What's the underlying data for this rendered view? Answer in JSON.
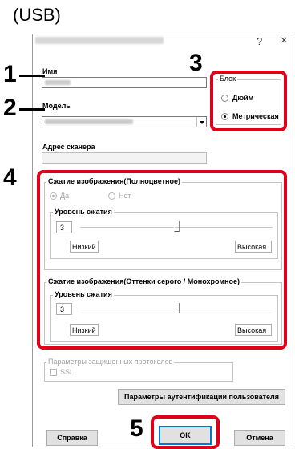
{
  "caption": "(USB)",
  "window": {
    "help_glyph": "?",
    "close_glyph": "×"
  },
  "callouts": [
    "1",
    "2",
    "3",
    "4",
    "5"
  ],
  "fields": {
    "name_label": "Имя",
    "model_label": "Модель",
    "scanner_address_label": "Адрес сканера"
  },
  "unit_group": {
    "title": "Блок",
    "options": [
      "Дюйм",
      "Метрическая"
    ],
    "selected": "Метрическая"
  },
  "color_compression": {
    "title": "Сжатие изображения(Полноцветное)",
    "yes_label": "Да",
    "no_label": "Нет",
    "level_title": "Уровень сжатия",
    "level_value": "3",
    "low_label": "Низкий",
    "high_label": "Высокая"
  },
  "gray_compression": {
    "title": "Сжатие изображения(Оттенки серого / Монохромное)",
    "level_title": "Уровень сжатия",
    "level_value": "3",
    "low_label": "Низкий",
    "high_label": "Высокая"
  },
  "secure": {
    "title": "Параметры защищенных протоколов",
    "ssl_label": "SSL"
  },
  "buttons": {
    "user_auth": "Параметры аутентификации пользователя",
    "help": "Справка",
    "ok": "OK",
    "cancel": "Отмена"
  }
}
